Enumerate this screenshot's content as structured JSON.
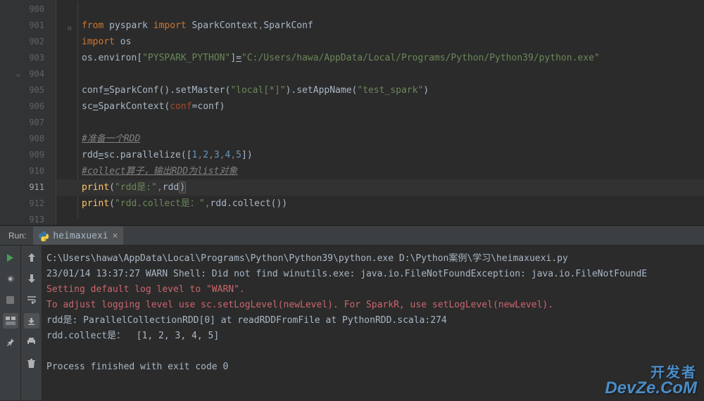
{
  "editor": {
    "lines": [
      {
        "num": "900",
        "html": ""
      },
      {
        "num": "901",
        "html": "<span class='kw'>from</span> pyspark <span class='kw'>import</span> SparkContext<span style='color:#808080'>,</span>SparkConf",
        "foldable": true
      },
      {
        "num": "902",
        "html": "<span class='kw'>import</span> os"
      },
      {
        "num": "903",
        "html": "os.environ[<span class='str'>\"PYSPARK_PYTHON\"</span>]<span style='text-decoration:underline'>=</span><span class='str'>\"C:/Users/hawa/AppData/Local/Programs/Python/Python39/python.exe\"</span>"
      },
      {
        "num": "904",
        "html": ""
      },
      {
        "num": "905",
        "html": "conf<span style='text-decoration:underline'>=</span>SparkConf().setMaster(<span class='str'>\"local[*]\"</span>).setAppName(<span class='str'>\"test_spark\"</span>)"
      },
      {
        "num": "906",
        "html": "sc<span style='text-decoration:underline'>=</span>SparkContext(<span class='param'>conf</span>=conf)"
      },
      {
        "num": "907",
        "html": ""
      },
      {
        "num": "908",
        "html": "<span class='comment underline'>#准备一个RDD</span>"
      },
      {
        "num": "909",
        "html": "rdd<span style='text-decoration:underline'>=</span>sc.parallelize([<span class='num'>1</span><span style='color:#808080'>,</span><span class='num'>2</span><span style='color:#808080'>,</span><span class='num'>3</span><span style='color:#808080'>,</span><span class='num'>4</span><span style='color:#808080'>,</span><span class='num'>5</span>])"
      },
      {
        "num": "910",
        "html": "<span class='comment underline'>#collect算子，输出RDD为list对象</span>"
      },
      {
        "num": "911",
        "html": "<span class='func'>print</span>(<span class='str'>\"rdd是:\"</span><span style='color:#808080'>,</span>rdd<span class='cursor-mark'>)</span>",
        "current": true
      },
      {
        "num": "912",
        "html": "<span class='func'>print</span>(<span class='str'>\"rdd.collect是：\"</span><span style='color:#808080'>,</span>rdd.collect())"
      },
      {
        "num": "913",
        "html": ""
      }
    ]
  },
  "run": {
    "label": "Run:",
    "tab_name": "heimaxuexi",
    "console_lines": [
      {
        "text": "C:\\Users\\hawa\\AppData\\Local\\Programs\\Python\\Python39\\python.exe D:\\Python案例\\学习\\heimaxuexi.py",
        "cls": ""
      },
      {
        "text": "23/01/14 13:37:27 WARN Shell: Did not find winutils.exe: java.io.FileNotFoundException: java.io.FileNotFoundE",
        "cls": ""
      },
      {
        "text": "Setting default log level to \"WARN\".",
        "cls": "warn"
      },
      {
        "text": "To adjust logging level use sc.setLogLevel(newLevel). For SparkR, use setLogLevel(newLevel).",
        "cls": "warn"
      },
      {
        "text": "rdd是: ParallelCollectionRDD[0] at readRDDFromFile at PythonRDD.scala:274",
        "cls": ""
      },
      {
        "text": "rdd.collect是：  [1, 2, 3, 4, 5]",
        "cls": ""
      },
      {
        "text": "",
        "cls": ""
      },
      {
        "text": "Process finished with exit code 0",
        "cls": ""
      }
    ]
  },
  "watermark": {
    "top": "开发者",
    "bottom": "DevZe.CoM"
  }
}
